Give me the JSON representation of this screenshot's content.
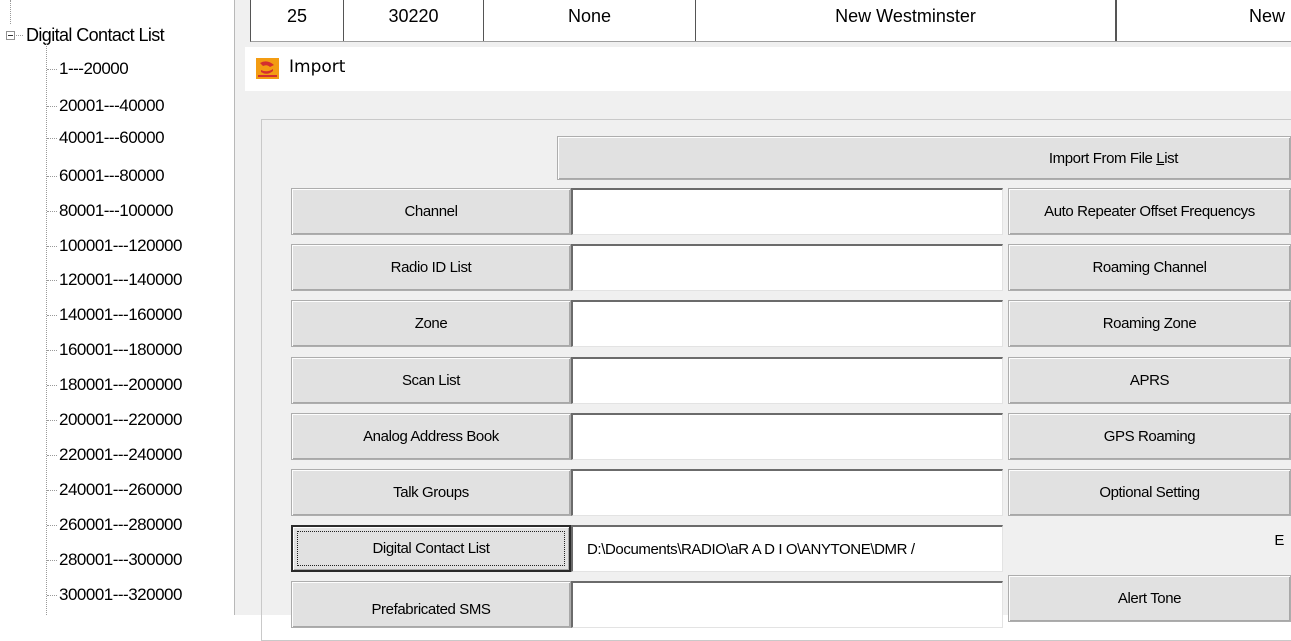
{
  "tree": {
    "root_label": "Digital Contact List",
    "items": [
      "1---20000",
      "20001---40000",
      "40001---60000",
      "60001---80000",
      "80001---100000",
      "100001---120000",
      "120001---140000",
      "140001---160000",
      "160001---180000",
      "180001---200000",
      "200001---220000",
      "220001---240000",
      "240001---260000",
      "260001---280000",
      "280001---300000",
      "300001---320000"
    ]
  },
  "grid": {
    "row": [
      "25",
      "30220",
      "None",
      "New Westminster",
      "New"
    ]
  },
  "dialog": {
    "title": "Import",
    "import_from_file_list": {
      "pre": "Import From File ",
      "accel": "L",
      "post": "ist"
    },
    "left_buttons": [
      "Channel",
      "Radio ID List",
      "Zone",
      "Scan List",
      "Analog Address Book",
      "Talk Groups",
      "Digital Contact List",
      "Prefabricated SMS"
    ],
    "fields": [
      "",
      "",
      "",
      "",
      "",
      "",
      "D:\\Documents\\RADIO\\aR A D I O\\ANYTONE\\DMR /",
      ""
    ],
    "right_buttons": [
      "Auto Repeater Offset Frequencys",
      "Roaming Channel",
      "Roaming Zone",
      "APRS",
      "GPS Roaming",
      "Optional Setting",
      "E",
      "Alert Tone"
    ]
  },
  "colors": {
    "icon_orange": "#f39c12",
    "icon_red": "#d32f2f"
  }
}
